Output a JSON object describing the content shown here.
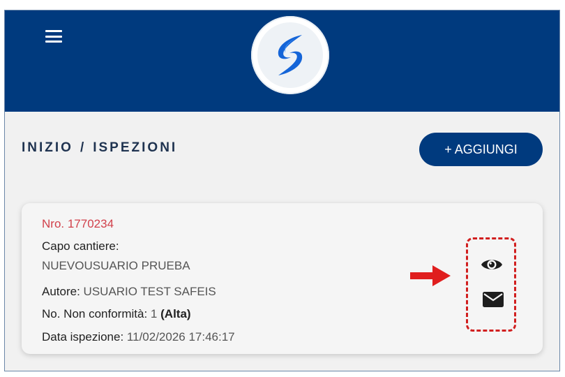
{
  "header": {
    "menu_icon": "hamburger-menu-icon",
    "logo_icon": "safeis-logo",
    "brand_color": "#003a7e"
  },
  "breadcrumb": {
    "home": "INIZIO",
    "separator": "/",
    "current": "ISPEZIONI"
  },
  "toolbar": {
    "add_label": "+ AGGIUNGI"
  },
  "inspection": {
    "number": "Nro. 1770234",
    "capo_label": "Capo cantiere:",
    "capo_value": "NUEVOUSUARIO PRUEBA",
    "autore_label": "Autore:",
    "autore_value": "USUARIO TEST SAFEIS",
    "nc_label": "No. Non conformità:",
    "nc_count": "1",
    "nc_severity": "(Alta)",
    "data_label": "Data ispezione:",
    "data_value": "11/02/2026 17:46:17",
    "number_color": "#d1414b",
    "actions": {
      "view_icon": "eye-icon",
      "mail_icon": "envelope-icon"
    }
  },
  "annotation": {
    "highlight_color": "#d11f1f",
    "arrow_icon": "arrow-right-icon"
  }
}
